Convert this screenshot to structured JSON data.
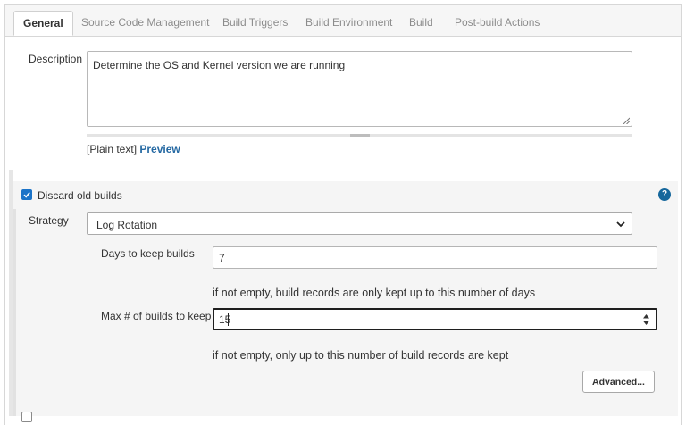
{
  "tabs": [
    {
      "label": "General",
      "active": true
    },
    {
      "label": "Source Code Management",
      "active": false
    },
    {
      "label": "Build Triggers",
      "active": false
    },
    {
      "label": "Build Environment",
      "active": false
    },
    {
      "label": "Build",
      "active": false
    },
    {
      "label": "Post-build Actions",
      "active": false
    }
  ],
  "description": {
    "label": "Description",
    "value": "Determine the OS and Kernel version we are running",
    "format_prefix": "[Plain text]",
    "preview_link": "Preview"
  },
  "discard_old_builds": {
    "checked": true,
    "label": "Discard old builds",
    "help_symbol": "?",
    "strategy": {
      "label": "Strategy",
      "selected": "Log Rotation"
    },
    "days_to_keep": {
      "label": "Days to keep builds",
      "value": "7",
      "hint": "if not empty, build records are only kept up to this number of days"
    },
    "max_builds": {
      "label": "Max # of builds to keep",
      "value": "15",
      "hint": "if not empty, only up to this number of build records are kept"
    },
    "advanced_button": "Advanced..."
  },
  "next_section": {
    "checked": false
  },
  "colors": {
    "accent_blue": "#1a73c8",
    "link_blue": "#2468a2",
    "help_blue": "#15679c",
    "section_bg": "#f5f5f5"
  },
  "icons": {
    "checkbox_checked": "check-icon",
    "help": "help-circle-icon",
    "select_arrow": "chevron-down-icon",
    "number_spinner": "spinner-arrows-icon",
    "textarea_resize": "resize-grip-icon"
  }
}
